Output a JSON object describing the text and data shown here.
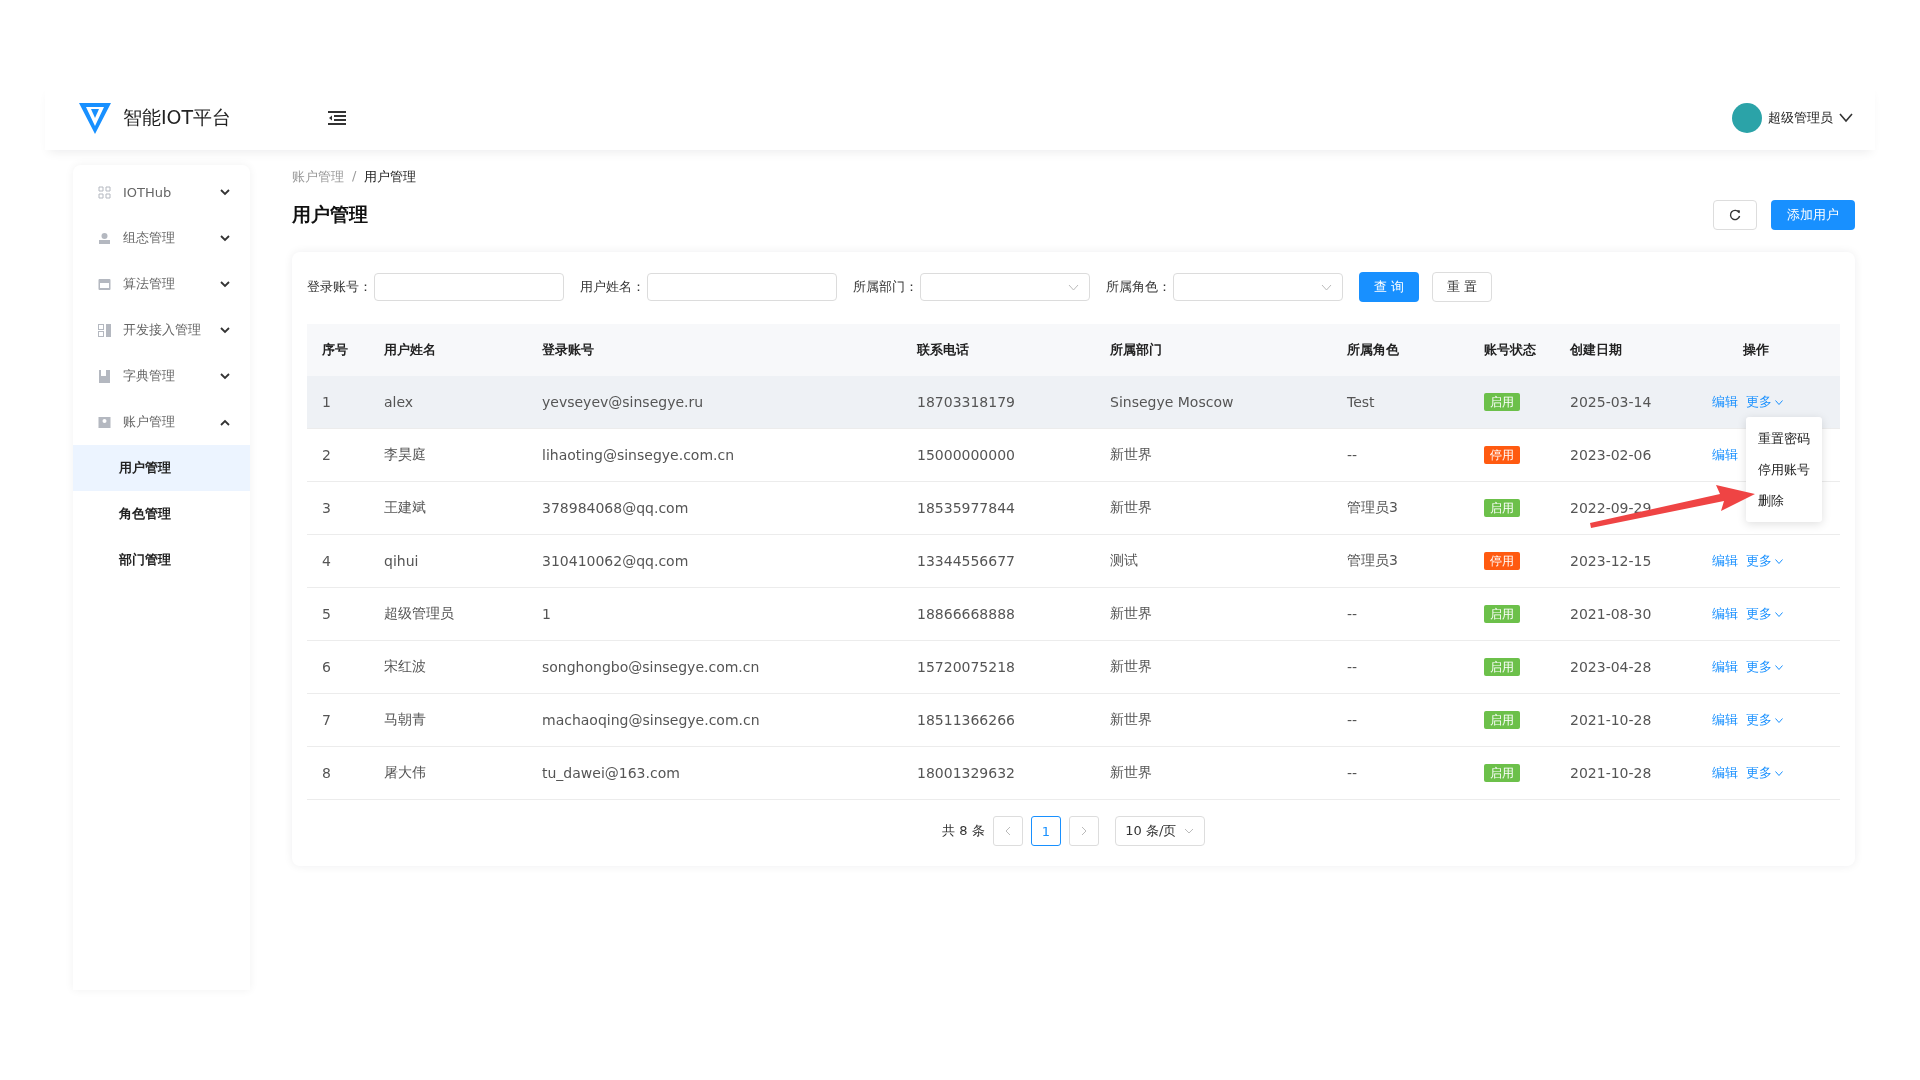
{
  "header": {
    "logo_text": "智能IOT平台",
    "user": "超级管理员"
  },
  "sidebar": {
    "items": [
      {
        "label": "IOTHub",
        "expanded": false
      },
      {
        "label": "组态管理",
        "expanded": false
      },
      {
        "label": "算法管理",
        "expanded": false
      },
      {
        "label": "开发接入管理",
        "expanded": false
      },
      {
        "label": "字典管理",
        "expanded": false
      },
      {
        "label": "账户管理",
        "expanded": true,
        "children": [
          {
            "label": "用户管理",
            "selected": true
          },
          {
            "label": "角色管理",
            "selected": false
          },
          {
            "label": "部门管理",
            "selected": false
          }
        ]
      }
    ]
  },
  "breadcrumb": [
    "账户管理",
    "用户管理"
  ],
  "breadcrumb_separator": "/",
  "page_title": "用户管理",
  "add_button": "添加用户",
  "filters": [
    {
      "label": "登录账号：",
      "kind": "input"
    },
    {
      "label": "用户姓名：",
      "kind": "input"
    },
    {
      "label": "所属部门：",
      "kind": "select"
    },
    {
      "label": "所属角色：",
      "kind": "select"
    }
  ],
  "query_button": "查 询",
  "reset_button": "重 置",
  "table": {
    "columns": [
      "序号",
      "用户姓名",
      "登录账号",
      "联系电话",
      "所属部门",
      "所属角色",
      "账号状态",
      "创建日期",
      "操作"
    ],
    "rows": [
      {
        "cells": [
          "1",
          "alex",
          "yevseyev@sinsegye.ru",
          "18703318179",
          "Sinsegye Moscow",
          "Test"
        ],
        "status": {
          "label": "启用",
          "on": true
        },
        "date": "2025-03-14",
        "actions": [
          "编辑",
          "更多"
        ],
        "hovered": true
      },
      {
        "cells": [
          "2",
          "李昊庭",
          "lihaoting@sinsegye.com.cn",
          "15000000000",
          "新世界",
          "--"
        ],
        "status": {
          "label": "停用",
          "on": false
        },
        "date": "2023-02-06",
        "actions": [
          "编辑"
        ],
        "hovered": false
      },
      {
        "cells": [
          "3",
          "王建斌",
          "378984068@qq.com",
          "18535977844",
          "新世界",
          "管理员3"
        ],
        "status": {
          "label": "启用",
          "on": true
        },
        "date": "2022-09-29",
        "hovered": false
      },
      {
        "cells": [
          "4",
          "qihui",
          "310410062@qq.com",
          "13344556677",
          "测试",
          "管理员3"
        ],
        "status": {
          "label": "停用",
          "on": false
        },
        "date": "2023-12-15",
        "actions": [
          "编辑",
          "更多"
        ],
        "hovered": false
      },
      {
        "cells": [
          "5",
          "超级管理员",
          "1",
          "18866668888",
          "新世界",
          "--"
        ],
        "status": {
          "label": "启用",
          "on": true
        },
        "date": "2021-08-30",
        "actions": [
          "编辑",
          "更多"
        ],
        "hovered": false
      },
      {
        "cells": [
          "6",
          "宋红波",
          "songhongbo@sinsegye.com.cn",
          "15720075218",
          "新世界",
          "--"
        ],
        "status": {
          "label": "启用",
          "on": true
        },
        "date": "2023-04-28",
        "actions": [
          "编辑",
          "更多"
        ],
        "hovered": false
      },
      {
        "cells": [
          "7",
          "马朝青",
          "machaoqing@sinsegye.com.cn",
          "18511366266",
          "新世界",
          "--"
        ],
        "status": {
          "label": "启用",
          "on": true
        },
        "date": "2021-10-28",
        "actions": [
          "编辑",
          "更多"
        ],
        "hovered": false
      },
      {
        "cells": [
          "8",
          "屠大伟",
          "tu_dawei@163.com",
          "18001329632",
          "新世界",
          "--"
        ],
        "status": {
          "label": "启用",
          "on": true
        },
        "date": "2021-10-28",
        "actions": [
          "编辑",
          "更多"
        ],
        "hovered": false
      }
    ]
  },
  "more_menu": [
    "重置密码",
    "停用账号",
    "删除"
  ],
  "pagination": {
    "total": "共 8 条",
    "pages": [
      {
        "label": "1",
        "selected": true
      }
    ],
    "page_size": "10 条/页"
  }
}
